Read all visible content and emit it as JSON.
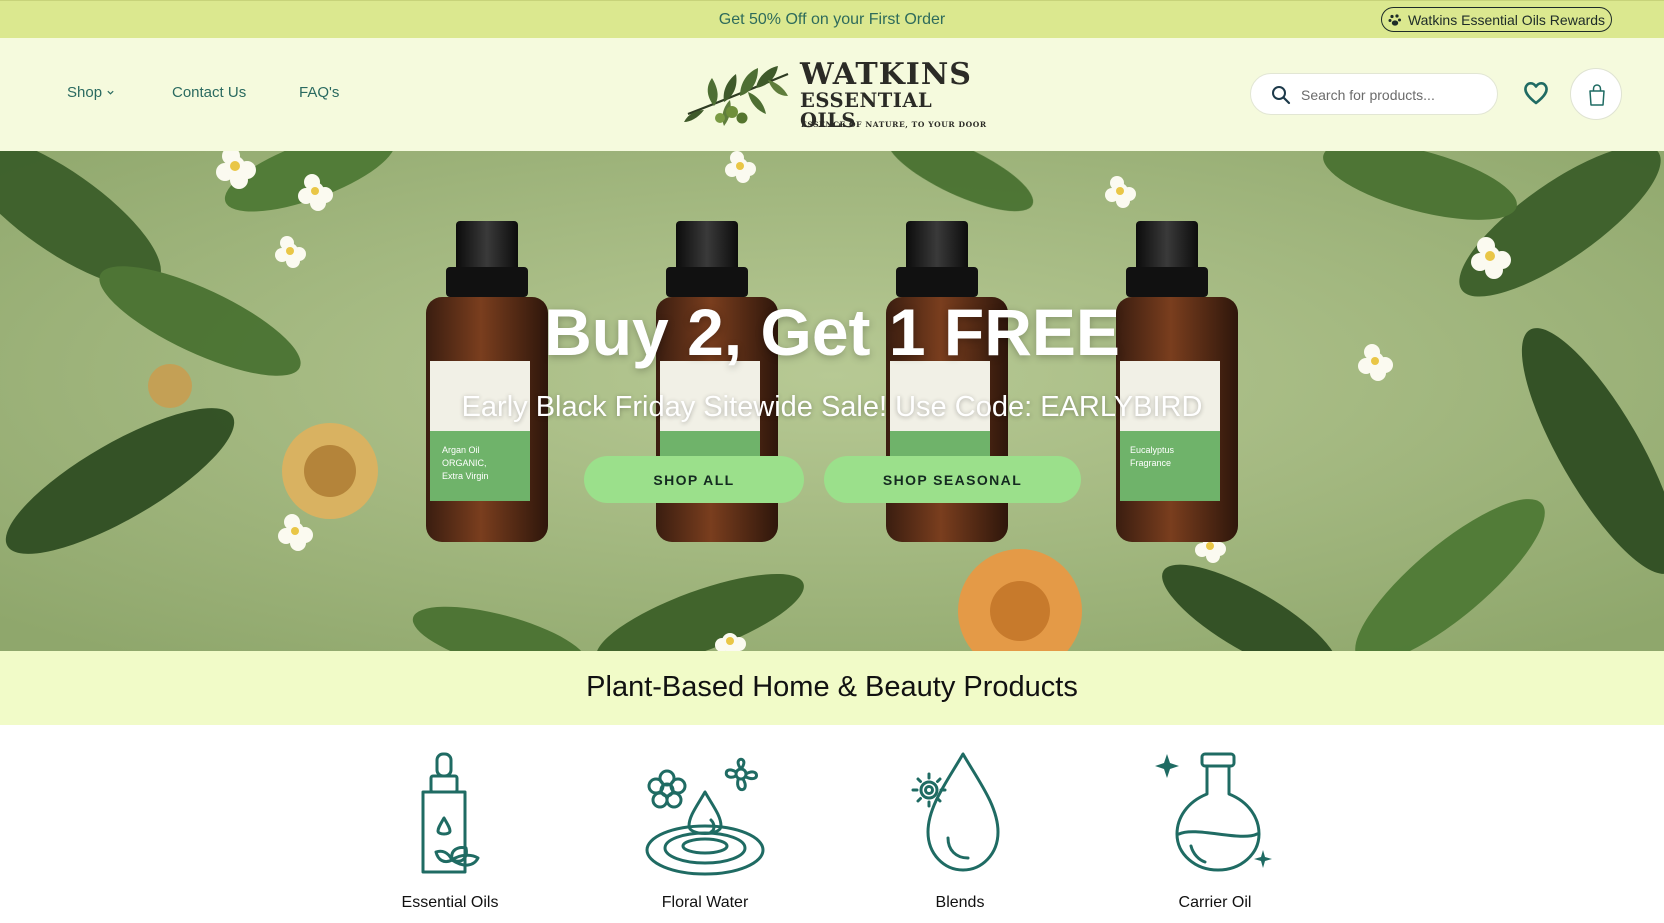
{
  "announcement": {
    "text": "Get 50% Off on your First Order",
    "rewards_label": "Watkins Essential Oils Rewards"
  },
  "header": {
    "nav": [
      {
        "label": "Shop"
      },
      {
        "label": "Contact Us"
      },
      {
        "label": "FAQ's"
      }
    ],
    "logo": {
      "line1": "WATKINS",
      "line2": "ESSENTIAL OILS",
      "tagline": "ESSENCE OF NATURE, TO YOUR DOOR"
    },
    "search": {
      "placeholder": "Search for products..."
    },
    "icons": [
      "search-icon",
      "heart-icon",
      "shopping-bag-icon"
    ]
  },
  "hero": {
    "title": "Buy 2, Get 1 FREE",
    "subtitle": "Early Black Friday Sitewide Sale! Use Code: EARLYBIRD",
    "buttons": [
      {
        "label": "SHOP ALL"
      },
      {
        "label": "SHOP SEASONAL"
      }
    ],
    "bottle_labels": [
      {
        "name": "Argan Oil ORGANIC, Extra Virgin"
      },
      {
        "name": ""
      },
      {
        "name": ""
      },
      {
        "name": "Eucalyptus Fragrance"
      }
    ]
  },
  "categories": {
    "heading": "Plant-Based Home & Beauty Products",
    "items": [
      {
        "label": "Essential Oils",
        "icon": "dropper-bottle-icon"
      },
      {
        "label": "Floral Water",
        "icon": "floral-water-icon"
      },
      {
        "label": "Blends",
        "icon": "drop-flower-icon"
      },
      {
        "label": "Carrier Oil",
        "icon": "flask-icon"
      }
    ]
  },
  "colors": {
    "announcement_bg": "#dbe88f",
    "header_bg": "#f5fadd",
    "accent_teal": "#1f6b63",
    "button_green": "#9be08b",
    "category_band_bg": "#f1fbc8"
  }
}
